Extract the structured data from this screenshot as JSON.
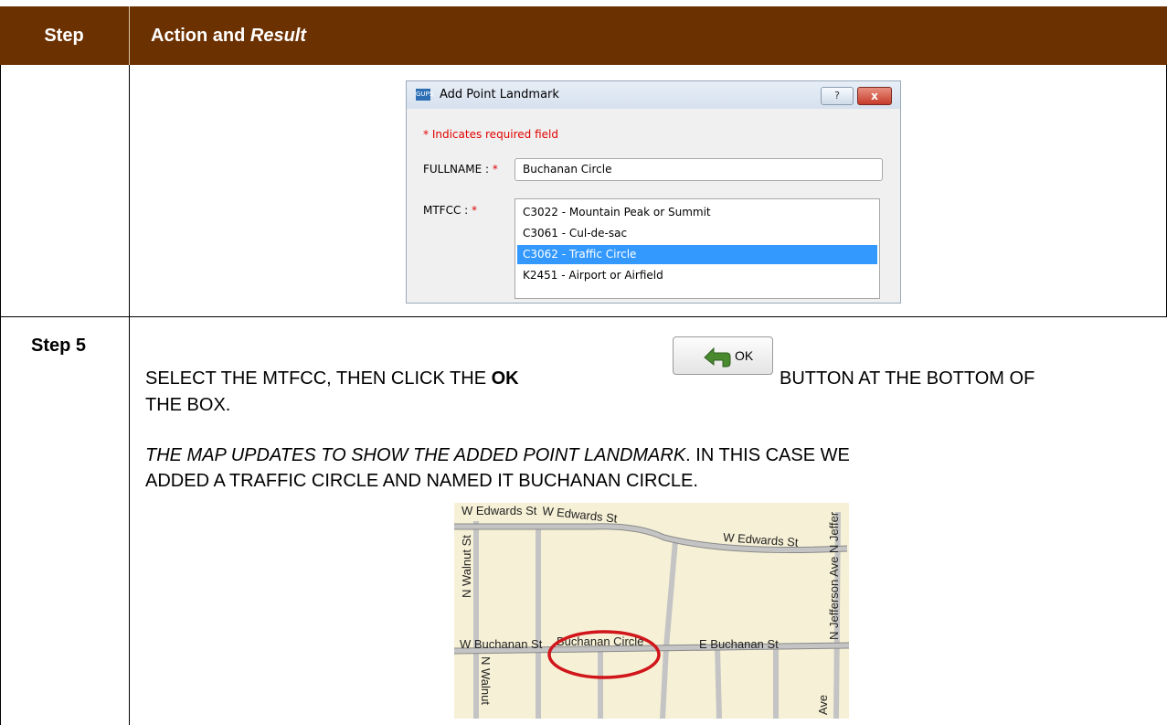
{
  "header": {
    "col1": "Step",
    "col2_prefix": "Action and ",
    "col2_italic": "Result"
  },
  "dialog": {
    "logo": "GUPS",
    "title": "Add Point Landmark",
    "help_icon": "?",
    "close_icon": "x",
    "required_note": "* Indicates required field",
    "fullname_label": "FULLNAME : ",
    "fullname_star": "*",
    "fullname_value": "Buchanan Circle",
    "mtfcc_label": "MTFCC : ",
    "mtfcc_star": "*",
    "mtfcc_options": [
      "C3022 - Mountain Peak or Summit",
      "C3061 - Cul-de-sac",
      "C3062 - Traffic Circle",
      "K2451 - Airport or Airfield"
    ],
    "mtfcc_selected": "C3062 - Traffic Circle"
  },
  "step5": {
    "label": "Step 5",
    "line1_prefix": "SELECT THE MTFCC, THEN CLICK THE ",
    "line1_bold": "OK",
    "line1_suffix": "BUTTON AT THE BOTTOM OF",
    "line2": "THE BOX.",
    "ok_button_label": "OK",
    "para2_italic": "THE MAP UPDATES TO SHOW THE ADDED POINT LANDMARK",
    "para2_rest": ". IN THIS CASE WE",
    "para2_line2": "ADDED A TRAFFIC CIRCLE AND NAMED IT BUCHANAN CIRCLE."
  },
  "map": {
    "labels": {
      "w_edwards_1": "W Edwards St",
      "w_edwards_2": "W Edwards St",
      "w_edwards_3": "W Edwards St",
      "n_walnut_1": "N Walnut St",
      "n_walnut_2": "N Walnut",
      "w_buchanan": "W Buchanan St",
      "buchanan_circle": "Buchanan Circle",
      "e_buchanan": "E Buchanan St",
      "n_jefferson": "N Jefferson Ave N Jeffer",
      "ave": "Ave"
    },
    "colors": {
      "background": "#f6f1d6",
      "roads": "#bdbdbd",
      "highlight": "#d0161b"
    }
  }
}
